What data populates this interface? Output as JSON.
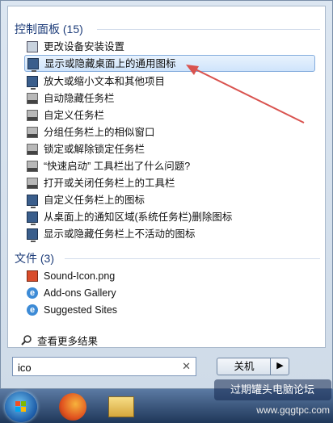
{
  "control_panel": {
    "header": "控制面板 (15)",
    "items": [
      {
        "label": "更改设备安装设置",
        "icon": "device-settings-icon"
      },
      {
        "label": "显示或隐藏桌面上的通用图标",
        "icon": "desktop-icon"
      },
      {
        "label": "放大或缩小文本和其他项目",
        "icon": "monitor-icon"
      },
      {
        "label": "自动隐藏任务栏",
        "icon": "taskbar-icon"
      },
      {
        "label": "自定义任务栏",
        "icon": "taskbar-icon"
      },
      {
        "label": "分组任务栏上的相似窗口",
        "icon": "taskbar-icon"
      },
      {
        "label": "锁定或解除锁定任务栏",
        "icon": "taskbar-icon"
      },
      {
        "label": "“快速启动” 工具栏出了什么问题?",
        "icon": "taskbar-icon"
      },
      {
        "label": "打开或关闭任务栏上的工具栏",
        "icon": "taskbar-icon"
      },
      {
        "label": "自定义任务栏上的图标",
        "icon": "notification-area-icon"
      },
      {
        "label": "从桌面上的通知区域(系统任务栏)删除图标",
        "icon": "notification-area-icon"
      },
      {
        "label": "显示或隐藏任务栏上不活动的图标",
        "icon": "notification-area-icon"
      }
    ]
  },
  "files": {
    "header": "文件 (3)",
    "items": [
      {
        "label": "Sound-Icon.png",
        "icon": "png-file-icon"
      },
      {
        "label": "Add-ons Gallery",
        "icon": "ie-icon"
      },
      {
        "label": "Suggested Sites",
        "icon": "ie-icon"
      }
    ]
  },
  "more_results": "查看更多结果",
  "search": {
    "value": "ico"
  },
  "shutdown_label": "关机",
  "watermark": "过期罐头电脑论坛",
  "watermark_url": "www.gqgtpc.com",
  "colors": {
    "accent": "#1e3d7a",
    "annotation_arrow": "#d9534f"
  }
}
